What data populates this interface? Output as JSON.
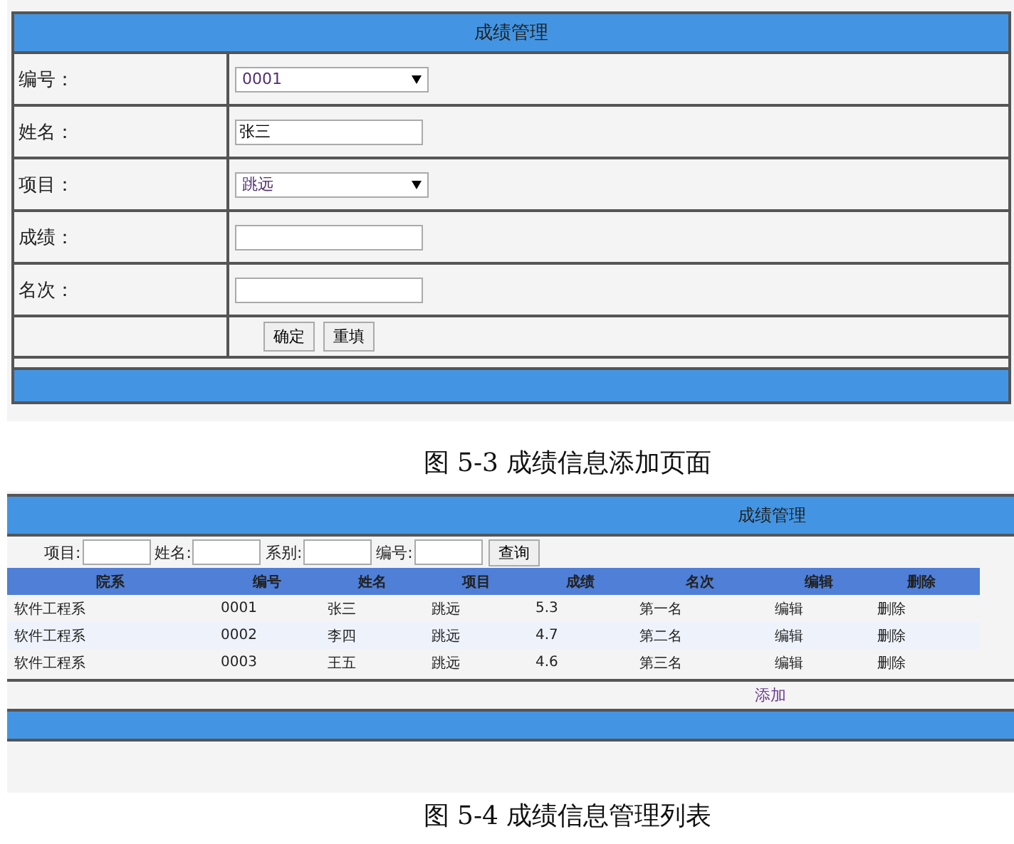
{
  "form_screen": {
    "title": "成绩管理",
    "fields": [
      {
        "kind": "select",
        "label": "编号：",
        "value": "0001"
      },
      {
        "kind": "text",
        "label": "姓名：",
        "value": "张三"
      },
      {
        "kind": "select",
        "label": "项目：",
        "value": "跳远"
      },
      {
        "kind": "text",
        "label": "成绩："
      },
      {
        "kind": "text",
        "label": "名次："
      }
    ],
    "buttons": [
      "确定",
      "重填"
    ]
  },
  "caption_1": "图 5-3 成绩信息添加页面",
  "list_screen": {
    "title": "成绩管理",
    "filters": [
      "项目:",
      "姓名:",
      "系别:",
      "编号:"
    ],
    "search_button": "查询",
    "columns": [
      "院系",
      "编号",
      "姓名",
      "项目",
      "成绩",
      "名次",
      "编辑",
      "删除"
    ],
    "rows": [
      [
        "软件工程系",
        "0001",
        "张三",
        "跳远",
        "5.3",
        "第一名",
        "编辑",
        "删除"
      ],
      [
        "软件工程系",
        "0002",
        "李四",
        "跳远",
        "4.7",
        "第二名",
        "编辑",
        "删除"
      ],
      [
        "软件工程系",
        "0003",
        "王五",
        "跳远",
        "4.6",
        "第三名",
        "编辑",
        "删除"
      ]
    ],
    "add_link": "添加"
  },
  "caption_2": "图 5-4 成绩信息管理列表"
}
